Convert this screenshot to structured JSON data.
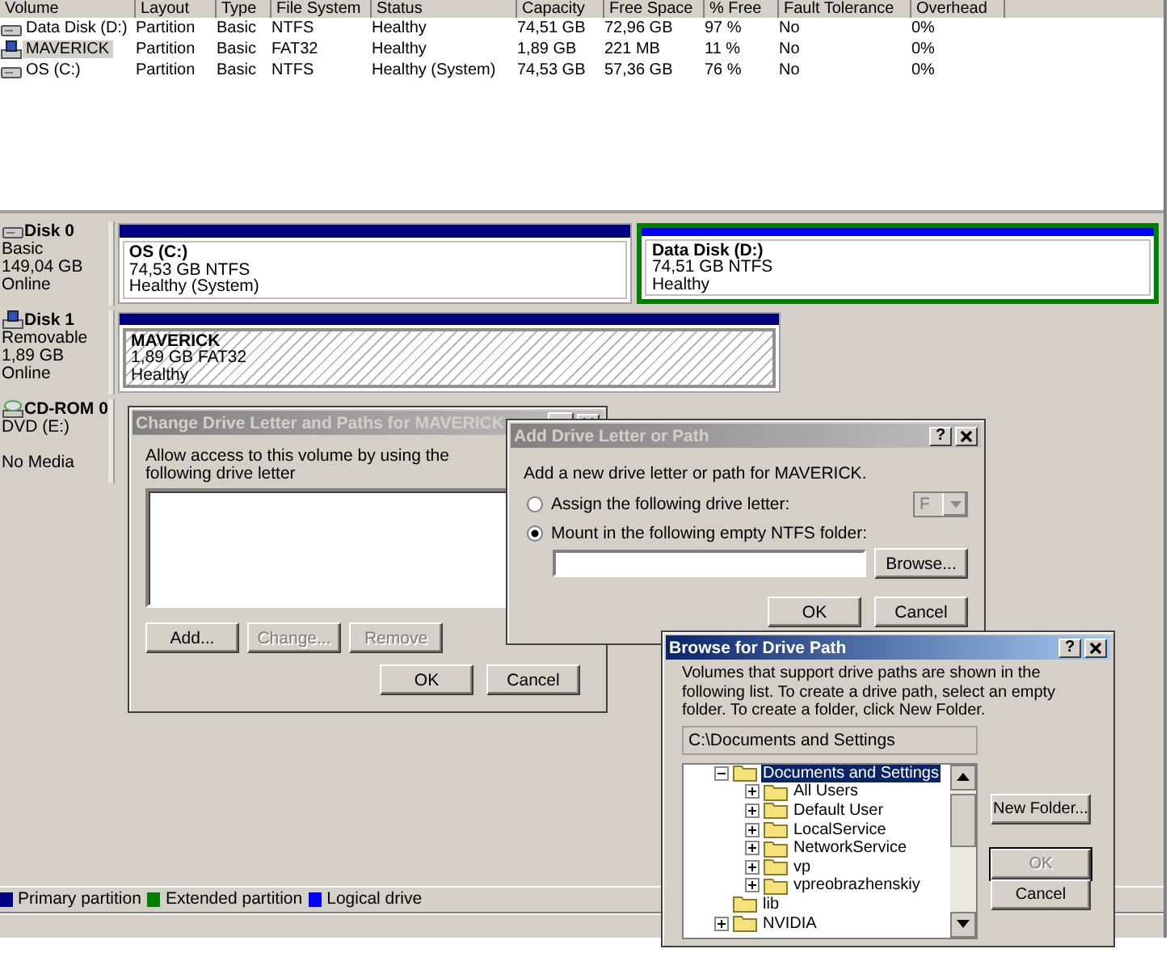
{
  "volume_list": {
    "columns": [
      "Volume",
      "Layout",
      "Type",
      "File System",
      "Status",
      "Capacity",
      "Free Space",
      "% Free",
      "Fault Tolerance",
      "Overhead"
    ],
    "rows": [
      {
        "kind": "fixed",
        "selected": false,
        "cells": [
          "Data Disk (D:)",
          "Partition",
          "Basic",
          "NTFS",
          "Healthy",
          "74,51 GB",
          "72,96 GB",
          "97 %",
          "No",
          "0%"
        ]
      },
      {
        "kind": "removable",
        "selected": true,
        "cells": [
          "MAVERICK",
          "Partition",
          "Basic",
          "FAT32",
          "Healthy",
          "1,89 GB",
          "221 MB",
          "11 %",
          "No",
          "0%"
        ]
      },
      {
        "kind": "fixed",
        "selected": false,
        "cells": [
          "OS (C:)",
          "Partition",
          "Basic",
          "NTFS",
          "Healthy (System)",
          "74,53 GB",
          "57,36 GB",
          "76 %",
          "No",
          "0%"
        ]
      }
    ]
  },
  "disks": [
    {
      "kind": "fixed",
      "name": "Disk 0",
      "details": [
        "Basic",
        "149,04 GB",
        "Online"
      ],
      "partitions": [
        {
          "kind": "primary",
          "selected": false,
          "name": "OS  (C:)",
          "size": "74,53 GB NTFS",
          "status": "Healthy (System)"
        },
        {
          "kind": "logical",
          "selected": false,
          "name": "Data Disk  (D:)",
          "size": "74,51 GB NTFS",
          "status": "Healthy"
        }
      ]
    },
    {
      "kind": "removable",
      "name": "Disk 1",
      "details": [
        "Removable",
        "1,89 GB",
        "Online"
      ],
      "partitions": [
        {
          "kind": "primary",
          "selected": true,
          "name": "MAVERICK",
          "size": "1,89 GB FAT32",
          "status": "Healthy"
        }
      ]
    },
    {
      "kind": "cdrom",
      "name": "CD-ROM 0",
      "details": [
        "DVD (E:)",
        "No Media"
      ]
    }
  ],
  "legend": [
    {
      "label": "Primary partition",
      "color": "#000080"
    },
    {
      "label": "Extended partition",
      "color": "#008000"
    },
    {
      "label": "Logical drive",
      "color": "#0000ff"
    }
  ],
  "change_dialog": {
    "title": "Change Drive Letter and Paths for MAVERICK",
    "active": false,
    "instruction": "Allow access to this volume by using the following drive letter",
    "buttons": [
      {
        "label": "Add...",
        "disabled": false
      },
      {
        "label": "Change...",
        "disabled": true
      },
      {
        "label": "Remove",
        "disabled": true
      }
    ],
    "footer_buttons": [
      "OK",
      "Cancel"
    ]
  },
  "add_dialog": {
    "title": "Add Drive Letter or Path",
    "active": false,
    "help_button": "?",
    "instruction": "Add a new drive letter or path for MAVERICK.",
    "options": [
      {
        "kind": "letter",
        "label": "Assign the following drive letter:",
        "selected": false,
        "value": "F"
      },
      {
        "kind": "folder",
        "label": "Mount in the following empty NTFS folder:",
        "selected": true
      }
    ],
    "browse_button": "Browse...",
    "footer_buttons": [
      "OK",
      "Cancel"
    ]
  },
  "browse_dialog": {
    "title": "Browse for Drive Path",
    "active": true,
    "help_button": "?",
    "description": "Volumes that support drive paths are shown in the following list. To create a drive path, select an empty folder. To create a folder, click New Folder.",
    "path": "C:\\Documents and Settings",
    "tree": [
      {
        "label": "Documents and Settings",
        "selected": true,
        "expanded": true,
        "children": [
          {
            "label": "All Users",
            "selected": false,
            "expanded": false
          },
          {
            "label": "Default User",
            "selected": false,
            "expanded": false
          },
          {
            "label": "LocalService",
            "selected": false,
            "expanded": false
          },
          {
            "label": "NetworkService",
            "selected": false,
            "expanded": false
          },
          {
            "label": "vp",
            "selected": false,
            "expanded": false
          },
          {
            "label": "vpreobrazhenskiy",
            "selected": false,
            "expanded": false
          }
        ]
      },
      {
        "label": "lib",
        "selected": false
      },
      {
        "label": "NVIDIA",
        "selected": false,
        "expanded": false
      }
    ],
    "buttons": [
      {
        "label": "New Folder...",
        "disabled": false
      },
      {
        "label": "OK",
        "disabled": true
      },
      {
        "label": "Cancel",
        "disabled": false
      }
    ]
  }
}
